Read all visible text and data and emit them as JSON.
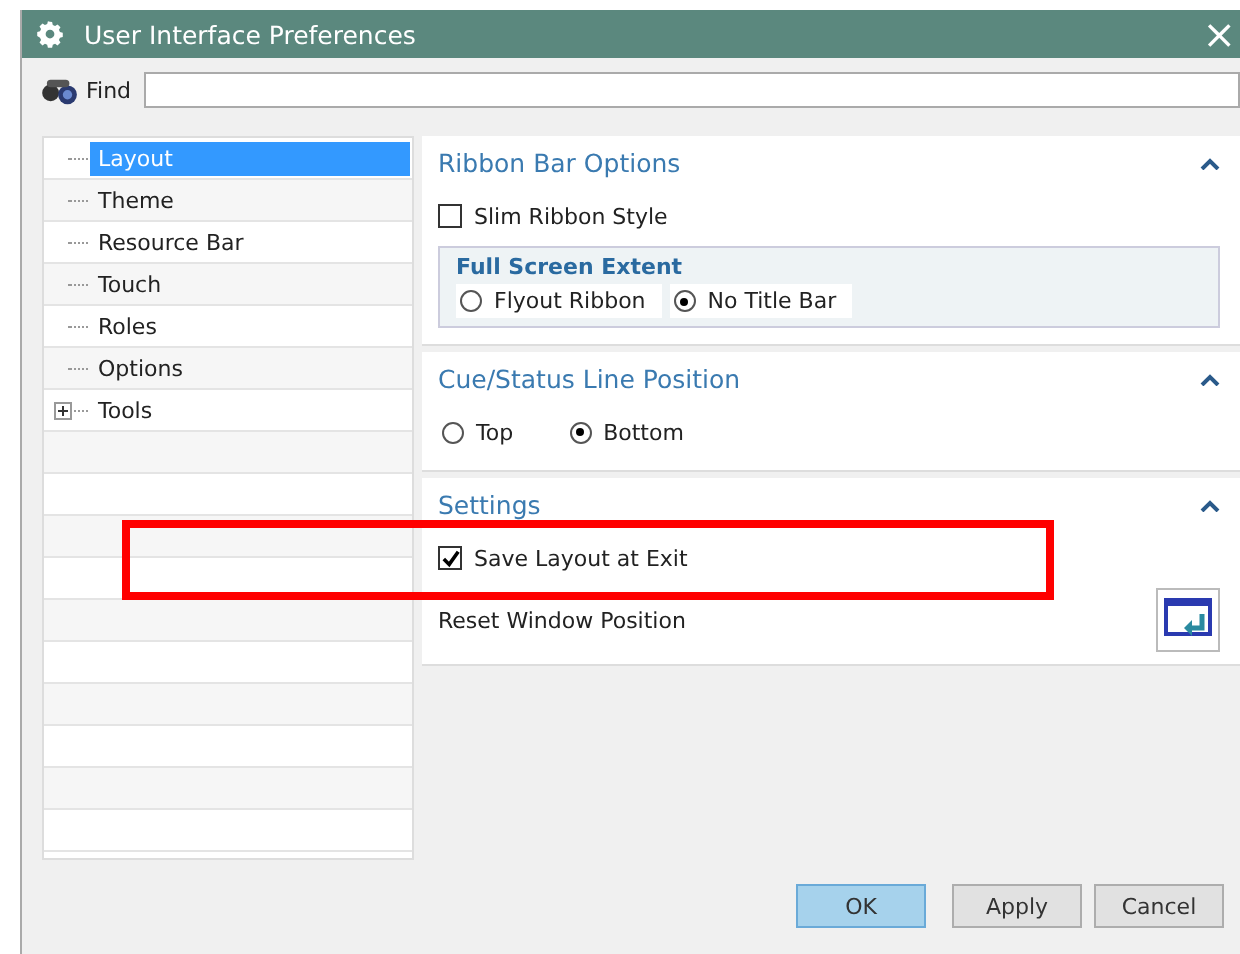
{
  "window": {
    "title": "User Interface Preferences",
    "close": "×"
  },
  "find": {
    "label": "Find"
  },
  "tree": [
    {
      "label": "Layout",
      "selected": true,
      "kind": "leaf"
    },
    {
      "label": "Theme",
      "selected": false,
      "kind": "leaf"
    },
    {
      "label": "Resource Bar",
      "selected": false,
      "kind": "leaf"
    },
    {
      "label": "Touch",
      "selected": false,
      "kind": "leaf"
    },
    {
      "label": "Roles",
      "selected": false,
      "kind": "leaf"
    },
    {
      "label": "Options",
      "selected": false,
      "kind": "leaf"
    },
    {
      "label": "Tools",
      "selected": false,
      "kind": "group",
      "expanded": false
    }
  ],
  "sections": [
    {
      "title": "Ribbon Bar Options",
      "expanded": true,
      "controls": [
        {
          "kind": "checkbox",
          "label": "Slim Ribbon Style",
          "checked": false
        },
        {
          "kind": "group_box",
          "title": "Full Screen Extent",
          "options": [
            {
              "label": "Flyout Ribbon",
              "selected": false
            },
            {
              "label": "No Title Bar",
              "selected": true
            }
          ]
        }
      ]
    },
    {
      "title": "Cue/Status Line Position",
      "expanded": true,
      "controls": [
        {
          "kind": "radio_row",
          "options": [
            {
              "label": "Top",
              "selected": false
            },
            {
              "label": "Bottom",
              "selected": true
            }
          ]
        }
      ]
    },
    {
      "title": "Settings",
      "expanded": true,
      "controls": [
        {
          "kind": "checkbox",
          "label": "Save Layout at Exit",
          "checked": true,
          "highlighted": true
        },
        {
          "kind": "action",
          "label": "Reset Window Position"
        }
      ]
    }
  ],
  "buttons": [
    {
      "label": "OK",
      "default": true
    },
    {
      "label": "Apply",
      "default": false
    },
    {
      "label": "Cancel",
      "default": false
    }
  ]
}
